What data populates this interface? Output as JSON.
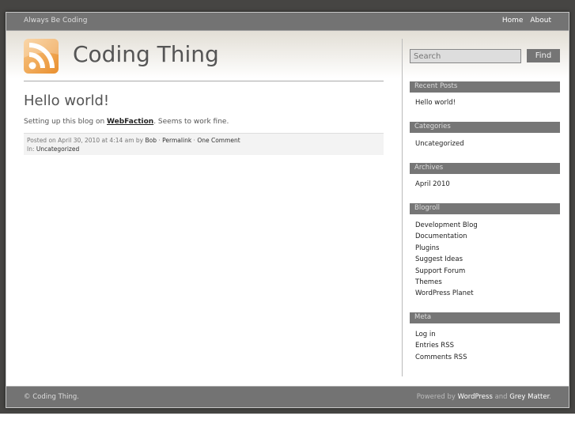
{
  "topbar": {
    "tagline": "Always Be Coding",
    "nav": [
      "Home",
      "About"
    ]
  },
  "header": {
    "title": "Coding Thing"
  },
  "post": {
    "title": "Hello world!",
    "body_prefix": "Setting up this blog on ",
    "body_link": "WebFaction",
    "body_suffix": ". Seems to work fine.",
    "meta_posted": "Posted on April 30, 2010 at 4:14 am by ",
    "author": "Bob",
    "sep": " · ",
    "permalink": "Permalink",
    "comments": "One Comment",
    "in_label": "In: ",
    "category": "Uncategorized"
  },
  "search": {
    "placeholder": "Search",
    "button": "Find"
  },
  "sidebar": {
    "recent": {
      "title": "Recent Posts",
      "items": [
        "Hello world!"
      ]
    },
    "categories": {
      "title": "Categories",
      "items": [
        "Uncategorized"
      ]
    },
    "archives": {
      "title": "Archives",
      "items": [
        "April 2010"
      ]
    },
    "blogroll": {
      "title": "Blogroll",
      "items": [
        "Development Blog",
        "Documentation",
        "Plugins",
        "Suggest Ideas",
        "Support Forum",
        "Themes",
        "WordPress Planet"
      ]
    },
    "meta": {
      "title": "Meta",
      "items": [
        "Log in",
        "Entries RSS",
        "Comments RSS"
      ]
    }
  },
  "footer": {
    "copyright": "© Coding Thing.",
    "powered_prefix": "Powered by ",
    "wordpress": "WordPress",
    "and": " and ",
    "theme": "Grey Matter",
    "dot": "."
  }
}
